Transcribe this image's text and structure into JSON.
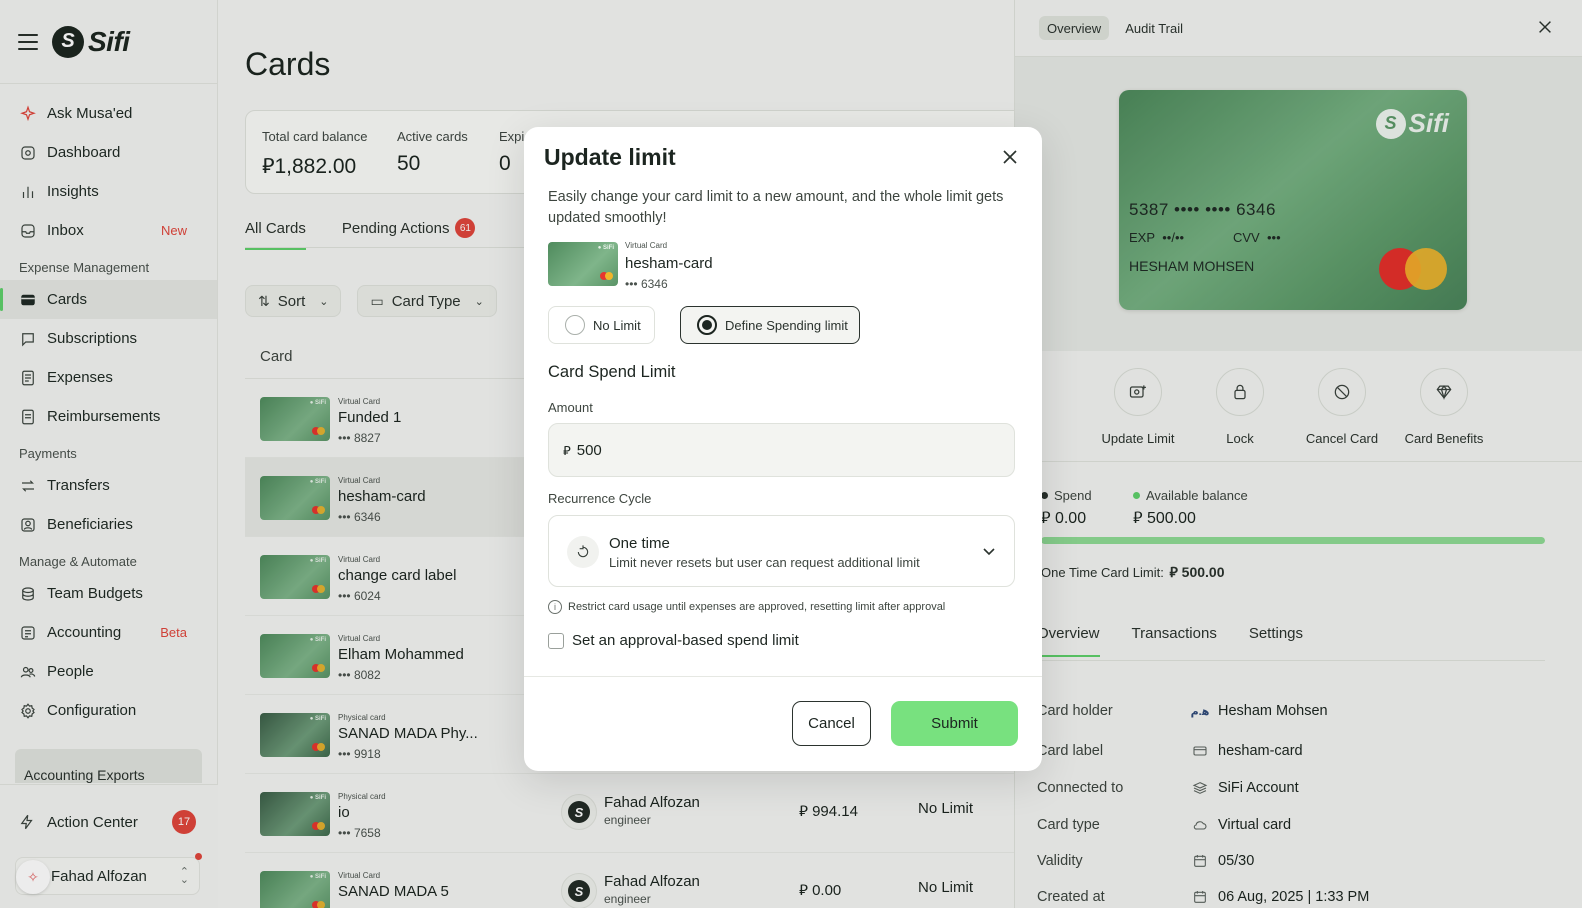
{
  "brand": {
    "logo_text": "Sifi",
    "logo_mark": "S"
  },
  "sidebar": {
    "items": [
      {
        "label": "Ask Musa'ed",
        "icon": "sparkle-icon"
      },
      {
        "label": "Dashboard",
        "icon": "dashboard-icon"
      },
      {
        "label": "Insights",
        "icon": "chart-icon"
      },
      {
        "label": "Inbox",
        "icon": "inbox-icon",
        "badge": "New"
      }
    ],
    "section_expense": "Expense Management",
    "expense_items": [
      {
        "label": "Cards",
        "icon": "card-icon",
        "active": true
      },
      {
        "label": "Subscriptions",
        "icon": "subscriptions-icon"
      },
      {
        "label": "Expenses",
        "icon": "expenses-icon"
      },
      {
        "label": "Reimbursements",
        "icon": "reimbursements-icon"
      }
    ],
    "section_payments": "Payments",
    "payment_items": [
      {
        "label": "Transfers",
        "icon": "transfers-icon"
      },
      {
        "label": "Beneficiaries",
        "icon": "beneficiaries-icon"
      }
    ],
    "section_manage": "Manage & Automate",
    "manage_items": [
      {
        "label": "Team Budgets",
        "icon": "budgets-icon"
      },
      {
        "label": "Accounting",
        "icon": "accounting-icon",
        "badge": "Beta"
      },
      {
        "label": "People",
        "icon": "people-icon"
      },
      {
        "label": "Configuration",
        "icon": "gear-icon"
      }
    ],
    "accounting_exports": "Accounting Exports",
    "action_center": "Action Center",
    "action_center_count": "17",
    "user_name": "Fahad Alfozan"
  },
  "main": {
    "title": "Cards",
    "stats": [
      {
        "label": "Total card balance",
        "value": "1,882.00",
        "currency": "⃁"
      },
      {
        "label": "Active cards",
        "value": "50"
      },
      {
        "label": "Expi",
        "value": "0"
      }
    ],
    "tabs": [
      {
        "label": "All Cards",
        "active": true
      },
      {
        "label": "Pending Actions",
        "badge": "61"
      }
    ],
    "filters": {
      "sort": "Sort",
      "card_type": "Card Type"
    },
    "table_header_card": "Card",
    "rows": [
      {
        "type": "Virtual Card",
        "name": "Funded 1",
        "last4": "••• 8827"
      },
      {
        "type": "Virtual Card",
        "name": "hesham-card",
        "last4": "••• 6346",
        "selected": true
      },
      {
        "type": "Virtual Card",
        "name": "change card label",
        "last4": "••• 6024"
      },
      {
        "type": "Virtual Card",
        "name": "Elham Mohammed",
        "last4": "••• 8082"
      },
      {
        "type": "Physical card",
        "name": "SANAD MADA Phy...",
        "last4": "••• 9918"
      },
      {
        "type": "Physical card",
        "name": "io",
        "last4": "••• 7658",
        "holder": "Fahad Alfozan",
        "role": "engineer",
        "amount": "994.14",
        "limit": "No Limit"
      },
      {
        "type": "Virtual Card",
        "name": "SANAD MADA 5",
        "last4": "",
        "holder": "Fahad Alfozan",
        "role": "engineer",
        "amount": "0.00",
        "limit": "No Limit"
      }
    ]
  },
  "panel": {
    "tabs": [
      {
        "label": "Overview",
        "active": true
      },
      {
        "label": "Audit Trail"
      }
    ],
    "card": {
      "number": "5387 •••• •••• 6346",
      "exp_label": "EXP",
      "exp_value": "••/••",
      "cvv_label": "CVV",
      "cvv_value": "•••",
      "holder": "HESHAM MOHSEN"
    },
    "actions": [
      {
        "label": "Update Limit",
        "icon": "update-limit-icon"
      },
      {
        "label": "Lock",
        "icon": "lock-icon"
      },
      {
        "label": "Cancel Card",
        "icon": "cancel-icon"
      },
      {
        "label": "Card Benefits",
        "icon": "diamond-icon"
      }
    ],
    "spend_label": "Spend",
    "spend_value": "0.00",
    "available_label": "Available balance",
    "available_value": "500.00",
    "available_fraction": 1.0,
    "one_time_label": "One Time Card Limit:",
    "one_time_value": "500.00",
    "detail_tabs": [
      {
        "label": "Overview",
        "active": true
      },
      {
        "label": "Transactions"
      },
      {
        "label": "Settings"
      }
    ],
    "details": [
      {
        "key": "Card holder",
        "value": "Hesham Mohsen",
        "icon": "holder-initials-icon",
        "icon_text": "ﻫ.م"
      },
      {
        "key": "Card label",
        "value": "hesham-card",
        "icon": "label-icon"
      },
      {
        "key": "Connected to",
        "value": "SiFi Account",
        "icon": "layers-icon"
      },
      {
        "key": "Card type",
        "value": "Virtual card",
        "icon": "cloud-icon"
      },
      {
        "key": "Validity",
        "value": "05/30",
        "icon": "calendar-icon"
      },
      {
        "key": "Created at",
        "value": "06 Aug, 2025 | 1:33 PM",
        "icon": "calendar-icon"
      }
    ],
    "colors": {
      "spend_dot": "#2b332e",
      "available_dot": "#5fd06a",
      "progress": "#8fdb94"
    }
  },
  "modal": {
    "title": "Update limit",
    "description": "Easily change your card limit to a new amount, and the whole limit gets updated smoothly!",
    "card_type": "Virtual Card",
    "card_name": "hesham-card",
    "card_last4": "••• 6346",
    "option_no_limit": "No Limit",
    "option_define": "Define Spending limit",
    "section_title": "Card Spend Limit",
    "amount_label": "Amount",
    "amount_value": "500",
    "currency": "⃁",
    "recurrence_label": "Recurrence Cycle",
    "recurrence_title": "One time",
    "recurrence_sub": "Limit never resets but user can request additional limit",
    "info_text": "Restrict card usage until expenses are approved, resetting limit after approval",
    "checkbox_label": "Set an approval-based spend limit",
    "cancel_label": "Cancel",
    "submit_label": "Submit",
    "colors": {
      "submit": "#78e17f",
      "accent": "#5fd06a"
    }
  }
}
